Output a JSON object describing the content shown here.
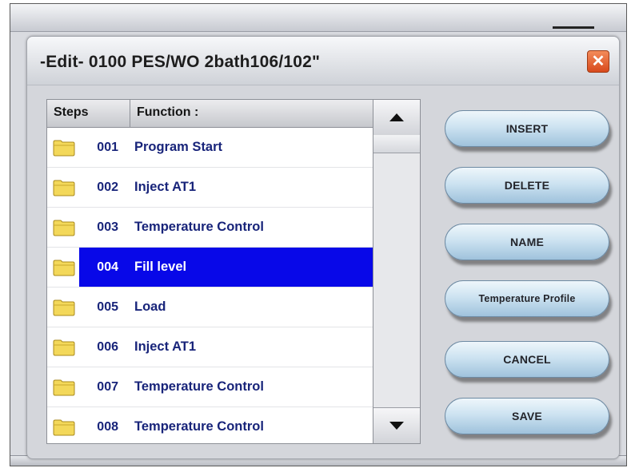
{
  "dialog": {
    "title": "-Edit- 0100 PES/WO 2bath106/102\"",
    "close_label": "✕"
  },
  "table": {
    "headers": {
      "steps": "Steps",
      "function": "Function :"
    },
    "selected_step": "004",
    "rows": [
      {
        "step": "001",
        "function": "Program Start"
      },
      {
        "step": "002",
        "function": "Inject AT1"
      },
      {
        "step": "003",
        "function": "Temperature Control"
      },
      {
        "step": "004",
        "function": "Fill level"
      },
      {
        "step": "005",
        "function": "Load"
      },
      {
        "step": "006",
        "function": "Inject AT1"
      },
      {
        "step": "007",
        "function": "Temperature Control"
      },
      {
        "step": "008",
        "function": "Temperature Control"
      }
    ]
  },
  "buttons": {
    "insert": "INSERT",
    "delete": "DELETE",
    "name": "NAME",
    "temperature_profile": "Temperature Profile",
    "cancel": "CANCEL",
    "save": "SAVE"
  },
  "colors": {
    "selection": "#0808e8",
    "row_text": "#18247a",
    "close_button": "#e0582a",
    "folder_icon": "#f3d85a"
  },
  "icons": {
    "row_icon": "folder-icon",
    "scroll_up": "up-arrow-icon",
    "scroll_down": "down-arrow-icon"
  }
}
